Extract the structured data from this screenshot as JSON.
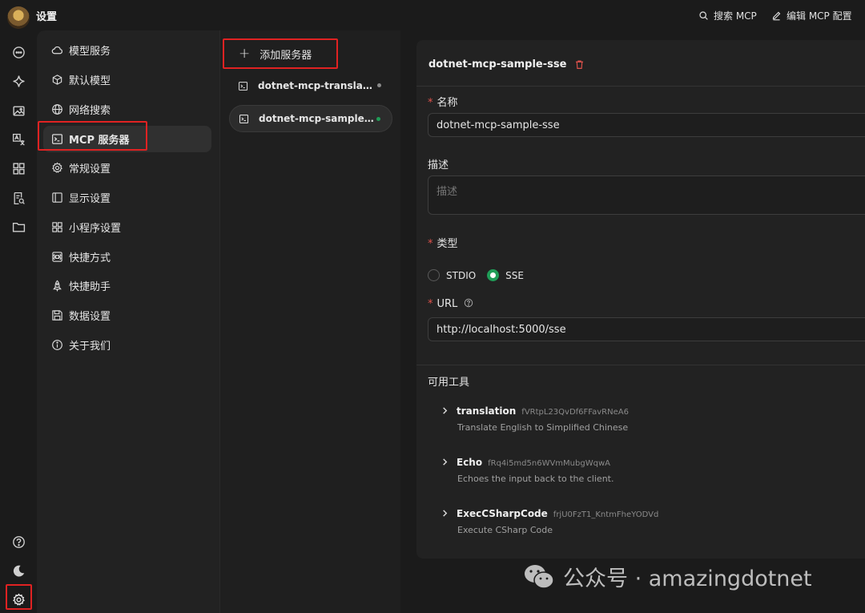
{
  "app": {
    "title": "设置"
  },
  "header": {
    "search_mcp": "搜索 MCP",
    "edit_mcp": "编辑 MCP 配置"
  },
  "rail": {
    "icons": [
      "chat-icon",
      "sparkle-icon",
      "image-icon",
      "translate-icon",
      "apps-grid-icon",
      "document-search-icon",
      "folder-icon",
      "help-icon",
      "moon-icon",
      "settings-icon"
    ]
  },
  "menu": {
    "items": [
      {
        "label": "模型服务",
        "icon": "cloud-icon"
      },
      {
        "label": "默认模型",
        "icon": "cube-icon"
      },
      {
        "label": "网络搜索",
        "icon": "globe-icon"
      },
      {
        "label": "MCP 服务器",
        "icon": "terminal-icon",
        "active": true
      },
      {
        "label": "常规设置",
        "icon": "gear-icon"
      },
      {
        "label": "显示设置",
        "icon": "display-icon"
      },
      {
        "label": "小程序设置",
        "icon": "grid-icon"
      },
      {
        "label": "快捷方式",
        "icon": "command-icon"
      },
      {
        "label": "快捷助手",
        "icon": "rocket-icon"
      },
      {
        "label": "数据设置",
        "icon": "save-icon"
      },
      {
        "label": "关于我们",
        "icon": "info-icon"
      }
    ]
  },
  "servers": {
    "add_label": "添加服务器",
    "items": [
      {
        "name": "dotnet-mcp-translation-...",
        "status": "inactive"
      },
      {
        "name": "dotnet-mcp-sample-sse",
        "status": "active",
        "selected": true
      }
    ]
  },
  "detail": {
    "title": "dotnet-mcp-sample-sse",
    "name_label": "名称",
    "name_value": "dotnet-mcp-sample-sse",
    "desc_label": "描述",
    "desc_placeholder": "描述",
    "type_label": "类型",
    "type_options": [
      "STDIO",
      "SSE"
    ],
    "type_selected": "SSE",
    "url_label": "URL",
    "url_value": "http://localhost:5000/sse",
    "tools_label": "可用工具",
    "tools": [
      {
        "name": "translation",
        "id": "fVRtpL23QvDf6FFavRNeA6",
        "desc": "Translate English to Simplified Chinese"
      },
      {
        "name": "Echo",
        "id": "fRq4i5md5n6WVmMubgWqwA",
        "desc": "Echoes the input back to the client."
      },
      {
        "name": "ExecCSharpCode",
        "id": "frjU0FzT1_KntmFheYODVd",
        "desc": "Execute CSharp Code"
      }
    ]
  },
  "watermark": {
    "text": "公众号 · amazingdotnet"
  },
  "colors": {
    "highlight_box": "#e02222",
    "active_green": "#1f9d57",
    "required_red": "#e0524c"
  }
}
